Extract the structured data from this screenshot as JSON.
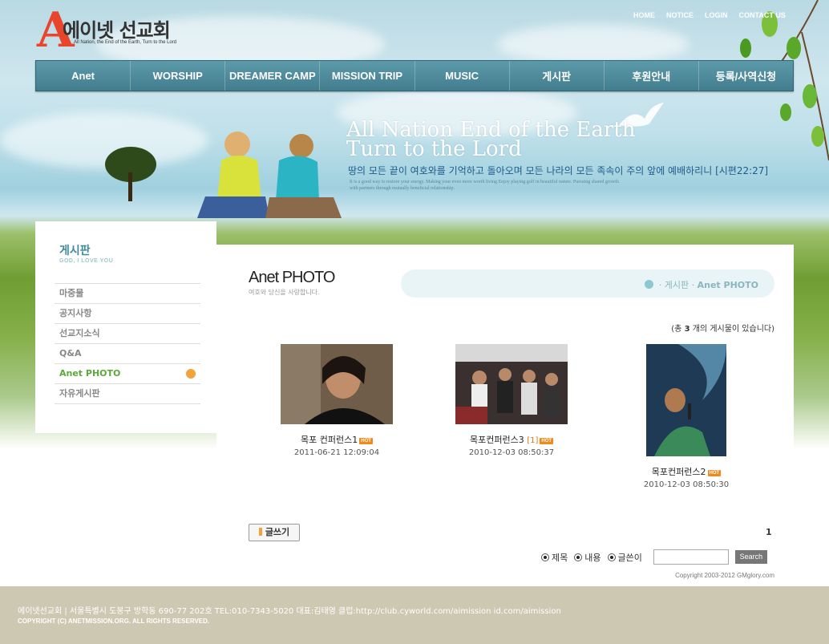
{
  "logo": {
    "initial": "A",
    "title": "에이넷 선교회",
    "subtitle": "All Nation, the End of the Earth, Turn to the Lord"
  },
  "top_links": [
    "HOME",
    "NOTICE",
    "LOGIN",
    "CONTACT US"
  ],
  "nav": [
    "Anet",
    "WORSHIP",
    "DREAMER CAMP",
    "MISSION TRIP",
    "MUSIC",
    "게시판",
    "후원안내",
    "등록/사역신청"
  ],
  "hero": {
    "line1": "All Nation End of the Earth",
    "line2": "Turn to the Lord",
    "verse": "땅의 모든 끝이 여호와를 기억하고 돌아오며 모든 나라의 모든 족속이 주의 앞에 예배하리니 [시편22:27]",
    "small": "It is a good way to restore your energy. Making your even more worth living Enjoy playing golf in beautiful nature. Pursuing shared growth with partners through mutually beneficial relationship."
  },
  "sidebar": {
    "heading": "게시판",
    "subheading": "GOD, I LOVE YOU",
    "items": [
      {
        "label": "마중물"
      },
      {
        "label": "공지사항"
      },
      {
        "label": "선교지소식"
      },
      {
        "label": "Q&A"
      },
      {
        "label": "Anet PHOTO",
        "active": true
      },
      {
        "label": "자유게시판"
      }
    ]
  },
  "content": {
    "title": "Anet PHOTO",
    "subtitle": "여호와 당신을 사랑합니다.",
    "breadcrumb": {
      "sep": "·",
      "board": "게시판",
      "current": "Anet PHOTO"
    },
    "total": {
      "prefix": "(총",
      "count": "3",
      "suffix": "개의 게시물이 있습니다)"
    },
    "photos": [
      {
        "title": "목포 컨퍼런스1",
        "comments": "",
        "badge": "HOT",
        "date": "2011-06-21 12:09:04"
      },
      {
        "title": "목포컨퍼런스3",
        "comments": "[1]",
        "badge": "HOT",
        "date": "2010-12-03 08:50:37"
      },
      {
        "title": "목포컨퍼런스2",
        "comments": "",
        "badge": "HOT",
        "date": "2010-12-03 08:50:30"
      }
    ],
    "write_button": "글쓰기",
    "page": "1",
    "search": {
      "options": [
        "제목",
        "내용",
        "글쓴이"
      ],
      "input_value": "",
      "button": "Search"
    },
    "copyright": "Copyright 2003-2012 GMglory.com"
  },
  "footer": {
    "info": "에이넷선교회 | 서울특별시 도봉구 방학동 690-77 202호   TEL:010-7343-5020   대표:김태영   클럽:http://club.cyworld.com/aimission  id.com/aimission",
    "rights": "COPYRIGHT (C) ANETMISSION.ORG. ALL RIGHTS RESERVED."
  }
}
